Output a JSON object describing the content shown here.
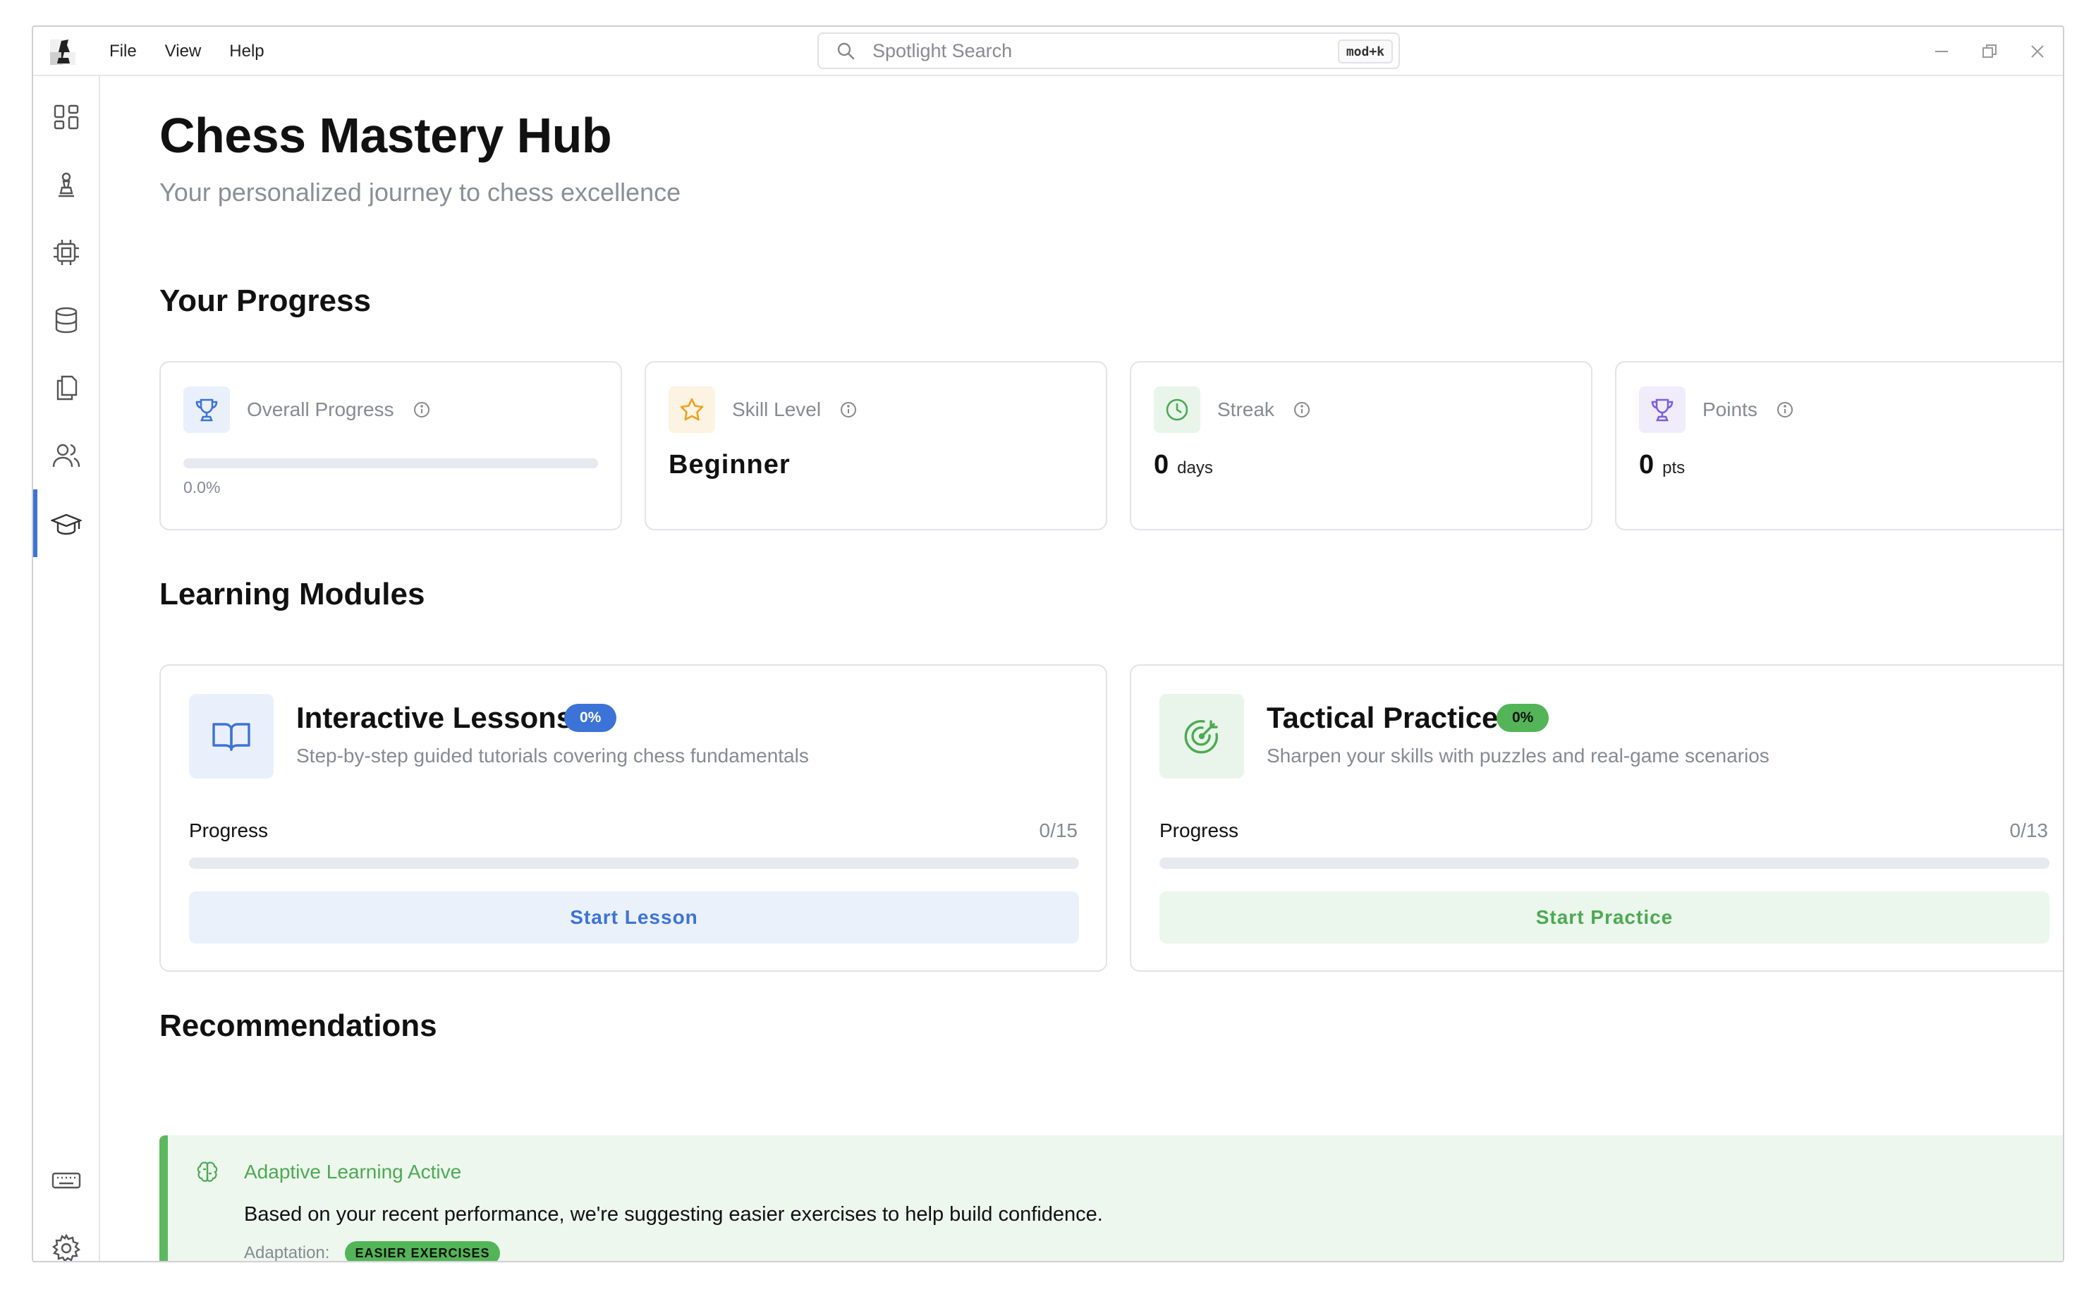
{
  "menu": {
    "file": "File",
    "view": "View",
    "help": "Help"
  },
  "search": {
    "placeholder": "Spotlight Search",
    "shortcut": "mod+k"
  },
  "header": {
    "title": "Chess Mastery Hub",
    "subtitle": "Your personalized journey to chess excellence"
  },
  "sections": {
    "progress": "Your Progress",
    "modules": "Learning Modules",
    "recommendations": "Recommendations"
  },
  "stats": {
    "overall": {
      "label": "Overall Progress",
      "percent_text": "0.0%",
      "percent": 0
    },
    "skill": {
      "label": "Skill Level",
      "value": "Beginner"
    },
    "streak": {
      "label": "Streak",
      "value": "0",
      "unit": "days"
    },
    "points": {
      "label": "Points",
      "value": "0",
      "unit": "pts"
    }
  },
  "modules": [
    {
      "title": "Interactive Lessons",
      "badge": "0%",
      "description": "Step-by-step guided tutorials covering chess fundamentals",
      "progress_label": "Progress",
      "progress_count": "0/15",
      "progress": 0,
      "button": "Start Lesson"
    },
    {
      "title": "Tactical Practice",
      "badge": "0%",
      "description": "Sharpen your skills with puzzles and real-game scenarios",
      "progress_label": "Progress",
      "progress_count": "0/13",
      "progress": 0,
      "button": "Start Practice"
    }
  ],
  "recommendation": {
    "title": "Adaptive Learning Active",
    "text": "Based on your recent performance, we're suggesting easier exercises to help build confidence.",
    "adaptation_label": "Adaptation:",
    "adaptation_value": "EASIER EXERCISES"
  },
  "colors": {
    "accent_blue": "#3c73d6",
    "accent_green": "#5cb85f",
    "star_orange": "#f0a020",
    "trophy_purple": "#7b5fe0"
  }
}
